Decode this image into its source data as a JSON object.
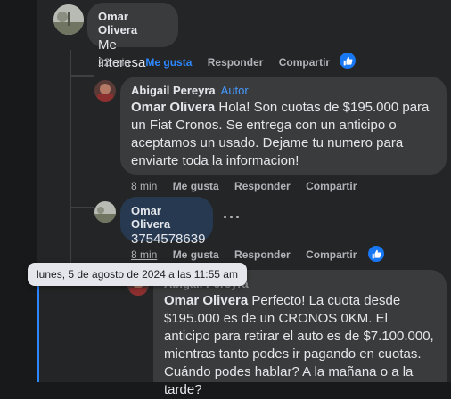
{
  "comments": [
    {
      "author": "Omar Olivera",
      "text": "Me interesa",
      "time": "22 min",
      "like": "Me gusta",
      "reply": "Responder",
      "share": "Compartir"
    },
    {
      "author": "Abigail Pereyra",
      "badge": "Autor",
      "mention": "Omar Olivera",
      "text": " Hola! Son cuotas de $195.000 para un Fiat Cronos. Se entrega con un anticipo o aceptamos un usado. Dejame tu numero para enviarte toda la informacion!",
      "time": "8 min",
      "like": "Me gusta",
      "reply": "Responder",
      "share": "Compartir"
    },
    {
      "author": "Omar Olivera",
      "text": "3754578639",
      "time": "8 min",
      "like": "Me gusta",
      "reply": "Responder",
      "share": "Compartir",
      "more": "···"
    },
    {
      "author": "Abigail Pereyra",
      "mention": "Omar Olivera",
      "text": " Perfecto! La cuota desde $195.000 es de un CRONOS 0KM. El anticipo para retirar el auto es de $7.100.000, mientras tanto podes ir pagando en cuotas. Cuándo podes hablar? A la mañana o a la tarde?"
    }
  ],
  "tooltip": "lunes, 5 de agosto de 2024 a las 11:55 am",
  "colors": {
    "accent": "#2d88ff",
    "like_blue": "#1877f2",
    "bubble": "#3a3b3c",
    "selected_bubble": "#263951"
  }
}
